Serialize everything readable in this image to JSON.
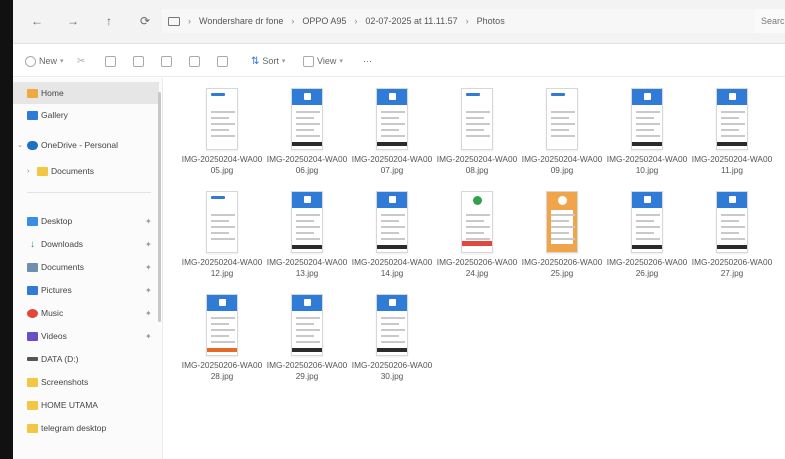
{
  "nav": {
    "back": "←",
    "forward": "→",
    "up": "↑",
    "refresh": "⟳"
  },
  "breadcrumb": {
    "items": [
      "Wondershare dr fone",
      "OPPO A95",
      "02-07-2025 at 11.11.57",
      "Photos"
    ],
    "separator": "›"
  },
  "search": {
    "placeholder": "Searc"
  },
  "toolbar": {
    "new_label": "New",
    "sort_label": "Sort",
    "view_label": "View",
    "more_label": "···"
  },
  "sidebar": {
    "home": "Home",
    "gallery": "Gallery",
    "onedrive": "OneDrive - Personal",
    "documents_cloud": "Documents",
    "desktop": "Desktop",
    "downloads": "Downloads",
    "documents": "Documents",
    "pictures": "Pictures",
    "music": "Music",
    "videos": "Videos",
    "data_drive": "DATA (D:)",
    "screenshots": "Screenshots",
    "folder_a": "HOME UTAMA",
    "folder_b": "telegram desktop"
  },
  "files": [
    {
      "name": "IMG-20250204-WA0005.jpg",
      "style": "t-light"
    },
    {
      "name": "IMG-20250204-WA0006.jpg",
      "style": "t-blue"
    },
    {
      "name": "IMG-20250204-WA0007.jpg",
      "style": "t-blue"
    },
    {
      "name": "IMG-20250204-WA0008.jpg",
      "style": "t-light"
    },
    {
      "name": "IMG-20250204-WA0009.jpg",
      "style": "t-light"
    },
    {
      "name": "IMG-20250204-WA0010.jpg",
      "style": "t-blue"
    },
    {
      "name": "IMG-20250204-WA0011.jpg",
      "style": "t-blue"
    },
    {
      "name": "IMG-20250204-WA0012.jpg",
      "style": "t-light"
    },
    {
      "name": "IMG-20250204-WA0013.jpg",
      "style": "t-blue"
    },
    {
      "name": "IMG-20250204-WA0014.jpg",
      "style": "t-blue"
    },
    {
      "name": "IMG-20250206-WA0024.jpg",
      "style": "t-green"
    },
    {
      "name": "IMG-20250206-WA0025.jpg",
      "style": "t-orange"
    },
    {
      "name": "IMG-20250206-WA0026.jpg",
      "style": "t-blue"
    },
    {
      "name": "IMG-20250206-WA0027.jpg",
      "style": "t-blue"
    },
    {
      "name": "IMG-20250206-WA0028.jpg",
      "style": "t-redbar"
    },
    {
      "name": "IMG-20250206-WA0029.jpg",
      "style": "t-blue"
    },
    {
      "name": "IMG-20250206-WA0030.jpg",
      "style": "t-blue"
    }
  ],
  "colors": {
    "accent": "#2f7bd6",
    "folder": "#f2c744",
    "selection": "#e6e6e6"
  }
}
